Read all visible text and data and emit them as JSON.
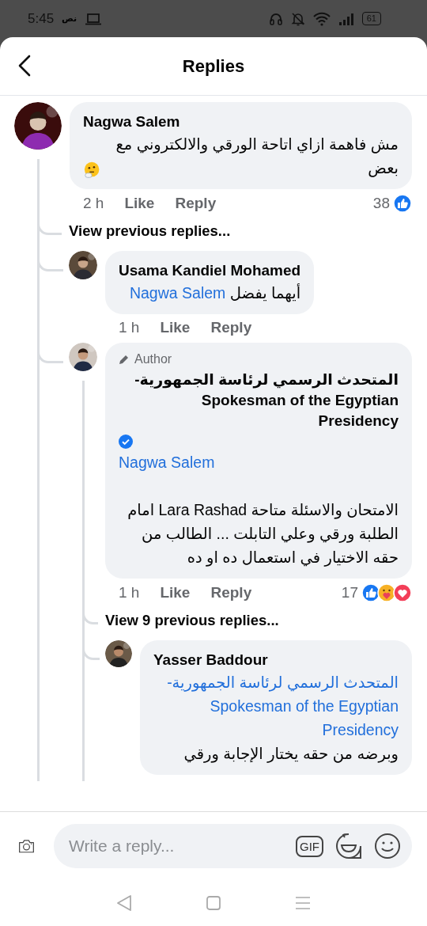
{
  "status_bar": {
    "time": "5:45",
    "carrier": "نص",
    "battery": "61"
  },
  "header": {
    "title": "Replies"
  },
  "thread": {
    "comment": {
      "author": "Nagwa Salem",
      "lines": [
        [
          {
            "kind": "text",
            "text": "مش فاهمة ازاي اتاحة الورقي والالكتروني مع بعض"
          }
        ]
      ],
      "emoji": true,
      "time": "2 h",
      "like": "Like",
      "reply": "Reply",
      "reaction_count": "38",
      "reactions": [
        {
          "kind": "like"
        }
      ]
    },
    "view_more": "View previous replies...",
    "replies": [
      {
        "comment": {
          "author": "Usama Kandiel Mohamed",
          "lines": [
            [
              {
                "kind": "text",
                "text": "أيهما يفضل"
              },
              {
                "kind": "mention",
                "text": "Nagwa Salem"
              }
            ]
          ],
          "time": "1 h",
          "like": "Like",
          "reply": "Reply"
        }
      },
      {
        "comment": {
          "author_badge": "Author",
          "author": "المتحدث الرسمي لرئاسة الجمهورية-Spokesman of the Egyptian Presidency",
          "verified": true,
          "lines": [
            [
              {
                "kind": "mention",
                "text": "Nagwa Salem"
              }
            ],
            [
              {
                "kind": "text",
                "text": "\nالامتحان والاسئلة متاحة Lara Rashad امام الطلبة ورقي وعلي التابلت ... الطالب من حقه الاختيار في استعمال ده او ده"
              }
            ]
          ],
          "time": "1 h",
          "like": "Like",
          "reply": "Reply",
          "reaction_count": "17",
          "reactions": [
            {
              "kind": "like"
            },
            {
              "kind": "care"
            },
            {
              "kind": "love"
            }
          ]
        },
        "view_more": "View 9 previous replies...",
        "replies": [
          {
            "comment": {
              "author": "Yasser Baddour",
              "lines": [
                [
                  {
                    "kind": "mention",
                    "text": "المتحدث الرسمي لرئاسة الجمهورية-Spokesman of the Egyptian Presidency"
                  }
                ],
                [
                  {
                    "kind": "text",
                    "text": "وبرضه من حقه يختار الإجابة ورقي"
                  }
                ]
              ]
            }
          }
        ]
      }
    ]
  },
  "composer": {
    "placeholder": "Write a reply...",
    "gif_label": "GIF"
  }
}
